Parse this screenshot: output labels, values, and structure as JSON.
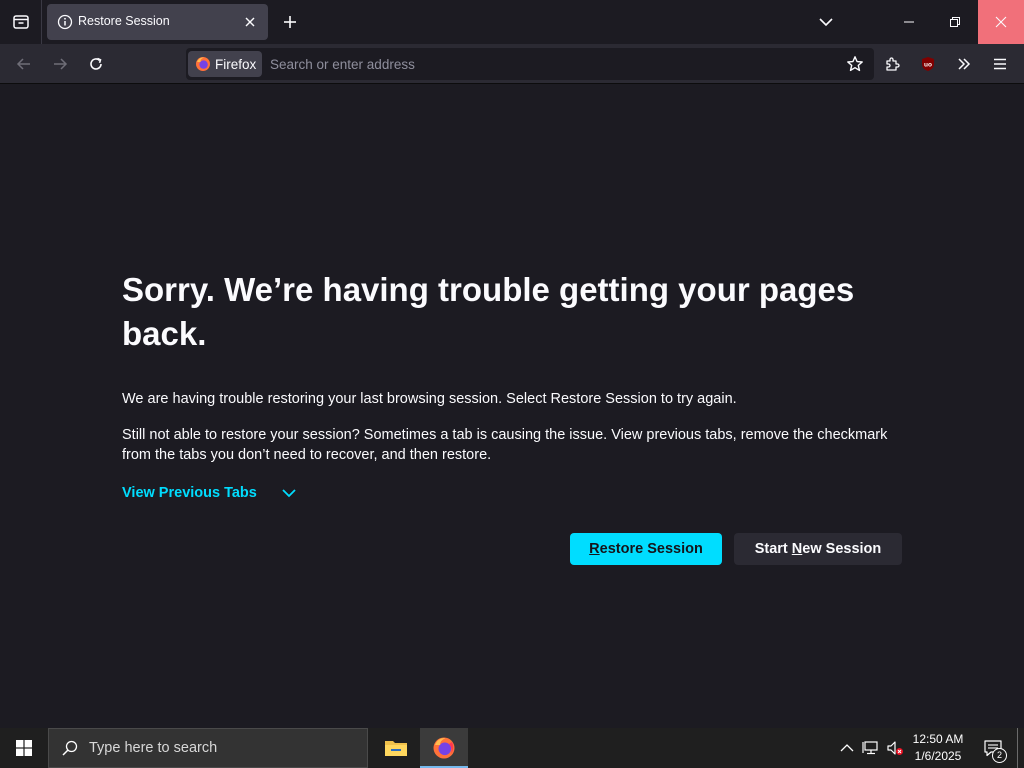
{
  "tab": {
    "title": "Restore Session"
  },
  "navbar": {
    "identity_label": "Firefox",
    "url_placeholder": "Search or enter address"
  },
  "content": {
    "title": "Sorry. We’re having trouble getting your pages back.",
    "paragraph1": "We are having trouble restoring your last browsing session. Select Restore Session to try again.",
    "paragraph2": "Still not able to restore your session? Sometimes a tab is causing the issue. View previous tabs, remove the checkmark from the tabs you don’t need to recover, and then restore.",
    "view_previous_tabs": "View Previous Tabs",
    "restore_button": {
      "access_key": "R",
      "rest": "estore Session"
    },
    "new_session_button": {
      "before": "Start ",
      "access_key": "N",
      "after": "ew Session"
    }
  },
  "taskbar": {
    "search_placeholder": "Type here to search",
    "time": "12:50 AM",
    "date": "1/6/2025",
    "notification_count": "2"
  },
  "icons": {
    "tab_list": "tab-list-icon",
    "tab_info": "info-icon",
    "tab_close": "close-icon",
    "new_tab": "plus-icon",
    "list_all_tabs": "chevron-down-icon",
    "back": "back-arrow-icon",
    "forward": "forward-arrow-icon",
    "reload": "reload-icon",
    "bookmark": "star-icon",
    "extensions": "puzzle-icon",
    "ublock": "ublock-origin-icon",
    "overflow": "double-chevron-icon",
    "menu": "hamburger-icon"
  },
  "colors": {
    "accent": "#00ddff",
    "page_background": "#1c1b22",
    "toolbar": "#2b2a33",
    "close_hover": "#f1707a",
    "ublock_red": "#800000"
  }
}
